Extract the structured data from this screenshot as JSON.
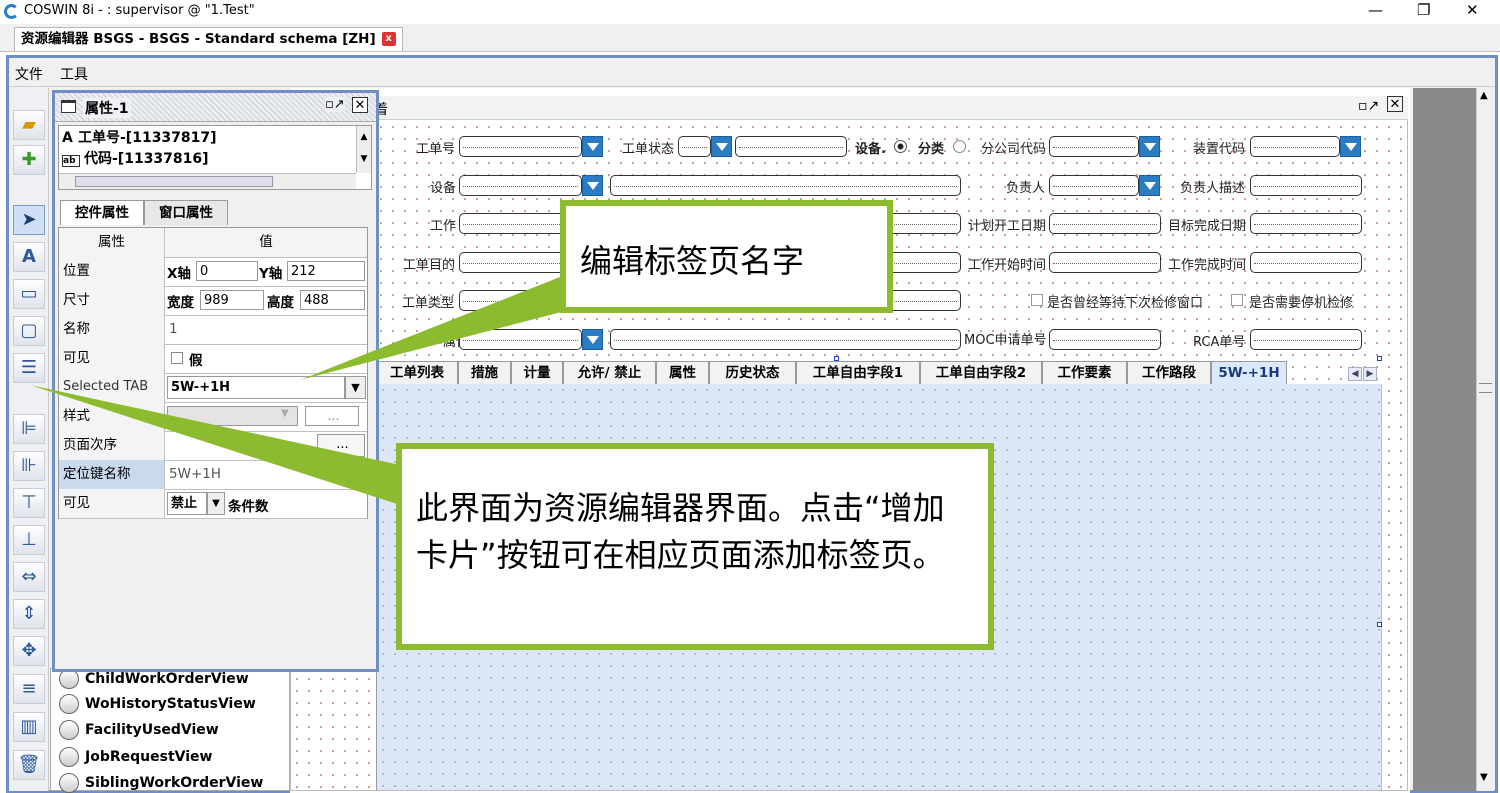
{
  "window": {
    "title": "COSWIN 8i -  : supervisor @ \"1.Test\"",
    "controls": [
      "—",
      "❐",
      "✕"
    ]
  },
  "doc_tab": {
    "label": "资源编辑器 BSGS - BSGS - Standard schema [ZH]",
    "close": "x"
  },
  "menu": {
    "file": "文件",
    "tools": "工具"
  },
  "inner_window": {
    "title": "着"
  },
  "form": {
    "row1": {
      "work_order_no": "工单号",
      "work_order_status": "工单状态",
      "device": "设备.",
      "category": "分类",
      "branch_code": "分公司代码",
      "unit_code": "装置代码"
    },
    "row2": {
      "device": "设备",
      "owner": "负责人",
      "owner_desc": "负责人描述"
    },
    "row3": {
      "work": "工作",
      "plan_start": "计划开工日期",
      "target_finish": "目标完成日期"
    },
    "row4": {
      "purpose": "工单目的",
      "work_start": "工作开始时间",
      "work_finish": "工作完成时间"
    },
    "row5": {
      "type": "工单类型",
      "check1": "是否曾经等待下次检修窗口",
      "check2": "是否需要停机检修"
    },
    "row6": {
      "attr": "属性",
      "moc": "MOC申请单号",
      "rca": "RCA单号"
    }
  },
  "tabs": [
    "工单列表",
    "措施",
    "计量",
    "允许/ 禁止",
    "属性",
    "历史状态",
    "工单自由字段1",
    "工单自由字段2",
    "工作要素",
    "工作路段",
    "5W-+1H"
  ],
  "tree_items": [
    "ChildWorkOrderView",
    "WoHistoryStatusView",
    "FacilityUsedView",
    "JobRequestView",
    "SiblingWorkOrderView"
  ],
  "properties": {
    "title": "属性-1",
    "list": [
      "工单号-[11337817]",
      "代码-[11337816]"
    ],
    "list_icons": [
      "A",
      "ab"
    ],
    "tab_control": "控件属性",
    "tab_window": "窗口属性",
    "header_prop": "属性",
    "header_value": "值",
    "position": {
      "label": "位置",
      "x_label": "X轴",
      "x": "0",
      "y_label": "Y轴",
      "y": "212"
    },
    "size": {
      "label": "尺寸",
      "w_label": "宽度",
      "w": "989",
      "h_label": "高度",
      "h": "488"
    },
    "name": {
      "label": "名称",
      "value": "1"
    },
    "visible1": {
      "label": "可见",
      "value": "假"
    },
    "selected_tab": {
      "label": "Selected TAB",
      "value": "5W-+1H"
    },
    "style": {
      "label": "样式",
      "btn": "..."
    },
    "page_order": {
      "label": "页面次序",
      "btn": "..."
    },
    "anchor": {
      "label": "定位键名称",
      "value": "5W+1H"
    },
    "visible2": {
      "label": "可见",
      "value": "禁止",
      "cond": "条件数"
    }
  },
  "callouts": {
    "small": "编辑标签页名字",
    "large": "此界面为资源编辑器界面。点击“增加卡片”按钮可在相应页面添加标签页。"
  },
  "colors": {
    "frame": "#6f8fc4",
    "callout_border": "#8dbb2f",
    "dropdown": "#2a7cc5"
  }
}
